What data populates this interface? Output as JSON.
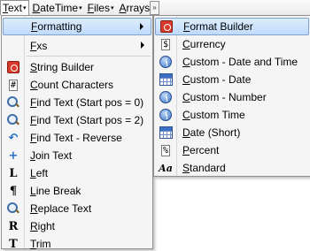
{
  "menubar": {
    "items": [
      {
        "label": "Text",
        "open": true
      },
      {
        "label": "DateTime"
      },
      {
        "label": "Files"
      },
      {
        "label": "Arrays"
      }
    ],
    "overflow_glyph": "»"
  },
  "main_menu": {
    "items": [
      {
        "label": "Formatting",
        "icon": "none",
        "submenu": true,
        "highlighted": true
      },
      {
        "label": "Fxs",
        "icon": "none",
        "submenu": true
      },
      {
        "label": "String Builder",
        "icon": "string-builder-icon"
      },
      {
        "label": "Count Characters",
        "icon": "count-characters-icon"
      },
      {
        "label": "Find Text (Start pos = 0)",
        "icon": "magnifier-icon"
      },
      {
        "label": "Find Text (Start pos = 2)",
        "icon": "magnifier-icon"
      },
      {
        "label": "Find Text - Reverse",
        "icon": "reverse-arrow-icon"
      },
      {
        "label": "Join Text",
        "icon": "plus-icon"
      },
      {
        "label": "Left",
        "icon": "letter-L-icon"
      },
      {
        "label": "Line Break",
        "icon": "pilcrow-icon"
      },
      {
        "label": "Replace Text",
        "icon": "replace-magnifier-icon"
      },
      {
        "label": "Right",
        "icon": "letter-R-icon"
      },
      {
        "label": "Trim",
        "icon": "letter-T-icon"
      }
    ]
  },
  "sub_menu": {
    "items": [
      {
        "label": "Format Builder",
        "icon": "format-builder-icon",
        "highlighted": true
      },
      {
        "label": "Currency",
        "icon": "currency-icon"
      },
      {
        "label": "Custom - Date and Time",
        "icon": "clock-icon"
      },
      {
        "label": "Custom - Date",
        "icon": "calendar-icon"
      },
      {
        "label": "Custom - Number",
        "icon": "clock-icon"
      },
      {
        "label": "Custom Time",
        "icon": "clock-icon"
      },
      {
        "label": "Date (Short)",
        "icon": "calendar-icon"
      },
      {
        "label": "Percent",
        "icon": "percent-icon"
      },
      {
        "label": "Standard",
        "icon": "standard-font-icon"
      }
    ]
  },
  "icon_glyphs": {
    "currency": "$",
    "count": "#",
    "pilcrow": "¶",
    "percent": "%",
    "standard": "Aa",
    "reverse": "↶",
    "plus": "+",
    "L": "L",
    "R": "R",
    "T": "T"
  },
  "colors": {
    "highlight_bg": "#c9defc",
    "highlight_border": "#7da2ce",
    "menu_bg": "#f5f5f5"
  }
}
